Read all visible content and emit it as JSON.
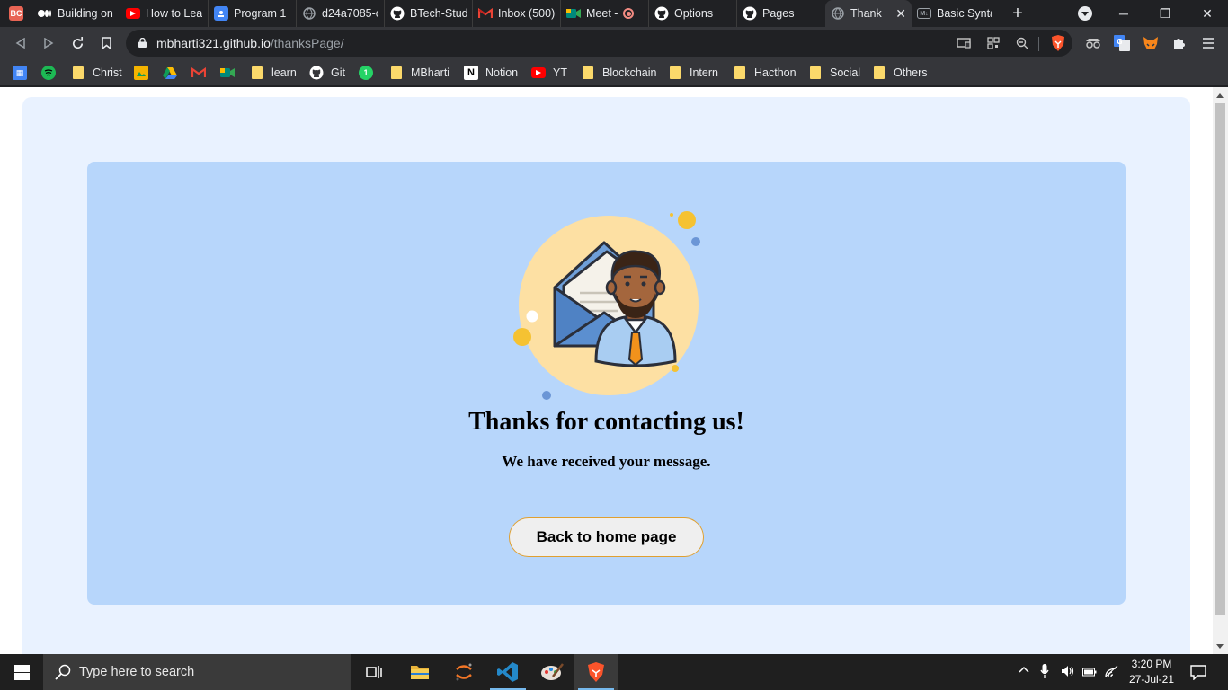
{
  "browser": {
    "tabs": [
      {
        "title": "",
        "favicon": "BC",
        "favicon_color": "#e86454"
      },
      {
        "title": "Building on",
        "favicon": "medium-icon",
        "favicon_color": "#ffffff"
      },
      {
        "title": "How to Lea",
        "favicon": "youtube-icon",
        "favicon_color": "#ff0000"
      },
      {
        "title": "Program 1",
        "favicon": "google-classroom-icon",
        "favicon_color": "#4285f4"
      },
      {
        "title": "d24a7085-c",
        "favicon": "globe-icon",
        "favicon_color": "#9aa0a6"
      },
      {
        "title": "BTech-Stud",
        "favicon": "github-icon",
        "favicon_color": "#ffffff"
      },
      {
        "title": "Inbox (500)",
        "favicon": "gmail-icon",
        "favicon_color": "#ea4335"
      },
      {
        "title": "Meet - ",
        "favicon": "google-meet-icon",
        "favicon_color": "#00897b"
      },
      {
        "title": "Options",
        "favicon": "github-icon",
        "favicon_color": "#ffffff"
      },
      {
        "title": "Pages",
        "favicon": "github-icon",
        "favicon_color": "#ffffff"
      },
      {
        "title": "Thank ",
        "favicon": "globe-icon",
        "favicon_color": "#9aa0a6",
        "active": true
      },
      {
        "title": "Basic Synta",
        "favicon": "markdown-icon",
        "favicon_color": "#9aa0a6"
      }
    ],
    "new_tab": "+",
    "window_controls": {
      "minimize": "─",
      "restore": "❐",
      "close": "✕"
    },
    "url_host": "mbharti321.github.io",
    "url_path": "/thanksPage/"
  },
  "bookmarks": [
    {
      "label": "",
      "icon": "google-classroom-icon",
      "color": "#4285f4"
    },
    {
      "label": "",
      "icon": "spotify-icon",
      "color": "#1db954"
    },
    {
      "label": "Christ",
      "icon": "folder-icon",
      "color": "#fbd96b"
    },
    {
      "label": "",
      "icon": "google-photos-icon",
      "color": "#f4b400"
    },
    {
      "label": "",
      "icon": "google-drive-icon",
      "color": "#0f9d58"
    },
    {
      "label": "",
      "icon": "gmail-icon",
      "color": "#ea4335"
    },
    {
      "label": "",
      "icon": "google-meet-icon",
      "color": "#00897b"
    },
    {
      "label": "learn",
      "icon": "folder-icon",
      "color": "#fbd96b"
    },
    {
      "label": "Git",
      "icon": "github-icon",
      "color": "#ffffff"
    },
    {
      "label": "",
      "icon": "whatsapp-icon",
      "color": "#25d366",
      "badge": "1"
    },
    {
      "label": "MBharti",
      "icon": "folder-icon",
      "color": "#fbd96b"
    },
    {
      "label": "Notion",
      "icon": "notion-icon",
      "color": "#ffffff"
    },
    {
      "label": "YT",
      "icon": "youtube-icon",
      "color": "#ff0000"
    },
    {
      "label": "Blockchain",
      "icon": "folder-icon",
      "color": "#fbd96b"
    },
    {
      "label": "Intern",
      "icon": "folder-icon",
      "color": "#fbd96b"
    },
    {
      "label": "Hacthon",
      "icon": "folder-icon",
      "color": "#fbd96b"
    },
    {
      "label": "Social",
      "icon": "folder-icon",
      "color": "#fbd96b"
    },
    {
      "label": "Others",
      "icon": "folder-icon",
      "color": "#fbd96b"
    }
  ],
  "page": {
    "heading": "Thanks for contacting us!",
    "subheading": "We have received your message.",
    "button_label": "Back to home page",
    "colors": {
      "outer_card": "#e9f2ff",
      "inner_card": "#b7d6fb",
      "button_border": "#e0a030",
      "illustration_circle": "#fde0a3"
    }
  },
  "taskbar": {
    "search_placeholder": "Type here to search",
    "time": "3:20 PM",
    "date": "27-Jul-21"
  }
}
